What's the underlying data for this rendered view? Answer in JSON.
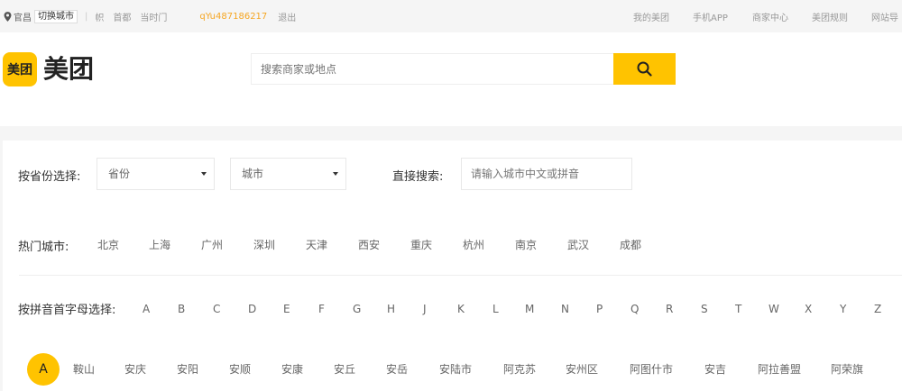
{
  "topbar": {
    "location": "官昌",
    "switch_city": "切换城市",
    "nav": [
      "帜",
      "首都",
      "当时门"
    ],
    "user": "qYu487186217",
    "logout": "退出",
    "right_links": [
      "我的美团",
      "手机APP",
      "商家中心",
      "美团规则",
      "网站导"
    ]
  },
  "header": {
    "logo_mark": "美团",
    "logo_text": "美团",
    "search_placeholder": "搜索商家或地点"
  },
  "filter": {
    "province_label": "按省份选择:",
    "province_select": "省份",
    "city_select": "城市",
    "direct_label": "直接搜索:",
    "direct_placeholder": "请输入城市中文或拼音"
  },
  "hot": {
    "label": "热门城市:",
    "cities": [
      "北京",
      "上海",
      "广州",
      "深圳",
      "天津",
      "西安",
      "重庆",
      "杭州",
      "南京",
      "武汉",
      "成都"
    ]
  },
  "pinyin": {
    "label": "按拼音首字母选择:",
    "letters": [
      "A",
      "B",
      "C",
      "D",
      "E",
      "F",
      "G",
      "H",
      "J",
      "K",
      "L",
      "M",
      "N",
      "P",
      "Q",
      "R",
      "S",
      "T",
      "W",
      "X",
      "Y",
      "Z"
    ]
  },
  "section_a": {
    "badge": "A",
    "cities": [
      "鞍山",
      "安庆",
      "安阳",
      "安顺",
      "安康",
      "安丘",
      "安岳",
      "安陆市",
      "阿克苏",
      "安州区",
      "阿图什市",
      "安吉",
      "阿拉善盟",
      "阿荣旗"
    ]
  },
  "colors": {
    "accent": "#ffc300",
    "user": "#f5a623"
  }
}
